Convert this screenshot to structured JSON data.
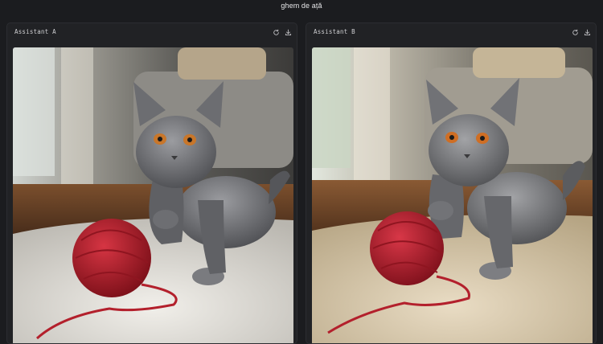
{
  "prompt": {
    "text": "ghem de ață"
  },
  "panels": [
    {
      "title": "Assistant A",
      "icons": {
        "regenerate": "refresh-icon",
        "download": "download-icon"
      },
      "image": {
        "subject": "gray cat playing with red yarn ball on white rug"
      }
    },
    {
      "title": "Assistant B",
      "icons": {
        "regenerate": "refresh-icon",
        "download": "download-icon"
      },
      "image": {
        "subject": "gray cat playing with red yarn ball on beige rug"
      }
    }
  ],
  "colors": {
    "background": "#1b1c1f",
    "panel": "#212225",
    "yarn": "#b3202c",
    "cat": "#6f7074"
  }
}
